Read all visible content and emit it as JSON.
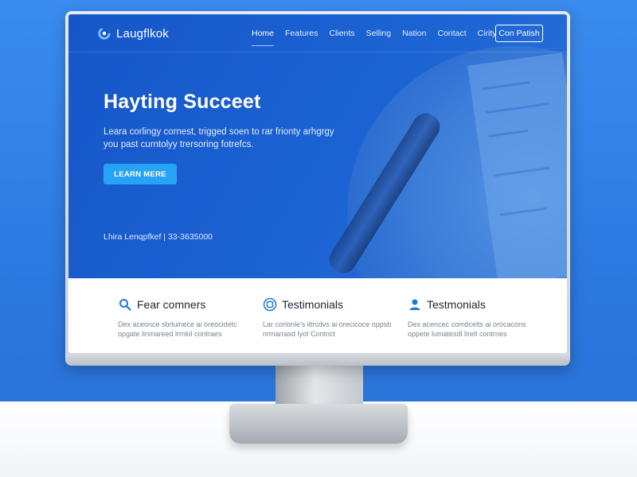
{
  "brand": {
    "name": "Laugflkok"
  },
  "nav": {
    "items": [
      "Home",
      "Features",
      "Clients",
      "Selling",
      "Nation",
      "Contact",
      "Cirity"
    ],
    "active_index": 0,
    "cta_label": "Con Patish"
  },
  "hero": {
    "title": "Hayting Succeet",
    "subtitle": "Leara corlingy cornest, trigged soen to rar frionty arhgrgy you past curntolyy trersoring fotrefcs.",
    "button_label": "LEARN MERE",
    "contact_line": "Lhira Lenqpfkef | 33-3635000"
  },
  "features": [
    {
      "title": "Fear comners",
      "icon": "search-icon",
      "desc": "Dex aceonce sbrluinece ai oreocidetc opgate linmareed lrrnkil contraes"
    },
    {
      "title": "Testimonials",
      "icon": "badge-icon",
      "desc": "Lar corlonle's iltrcdvs ai orecicoce oppsb nrmarrasd lyot Contnct"
    },
    {
      "title": "Testmonials",
      "icon": "person-icon",
      "desc": "Dex acencec corntlcelts ai orocacons oppete lumatesdl lirelt contrnes"
    }
  ],
  "colors": {
    "hero_blue": "#1656c9",
    "accent": "#27a3f5",
    "icon_blue": "#1d79d8"
  }
}
